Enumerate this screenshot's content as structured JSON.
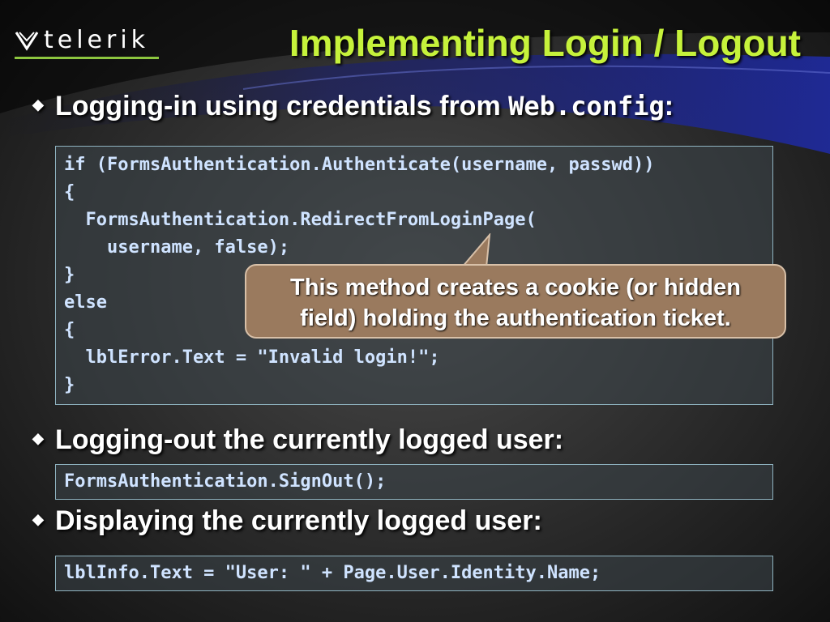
{
  "logo": {
    "text": "telerik"
  },
  "slide": {
    "title": "Implementing Login / Logout",
    "bullets": [
      {
        "text": "Logging-in using credentials from ",
        "code": "Web.config",
        "suffix": ":"
      },
      {
        "text": "Logging-out the currently logged user:"
      },
      {
        "text": "Displaying the currently logged user:"
      }
    ],
    "code_login": [
      "if (FormsAuthentication.Authenticate(username, passwd))",
      "{",
      "  FormsAuthentication.RedirectFromLoginPage(",
      "    username, false);",
      "}",
      "else",
      "{",
      "  lblError.Text = \"Invalid login!\";",
      "}"
    ],
    "code_logout": "FormsAuthentication.SignOut();",
    "code_display": "lblInfo.Text = \"User: \" + Page.User.Identity.Name;",
    "callout": [
      "This method creates a cookie (or hidden",
      "field) holding the authentication ticket."
    ]
  },
  "colors": {
    "title": "#c6f23b",
    "bullet_text": "#ffffff",
    "code_text": "#cfe3ff",
    "callout_bg": "#9a7a5e",
    "logo_accent": "#8dc63f"
  }
}
